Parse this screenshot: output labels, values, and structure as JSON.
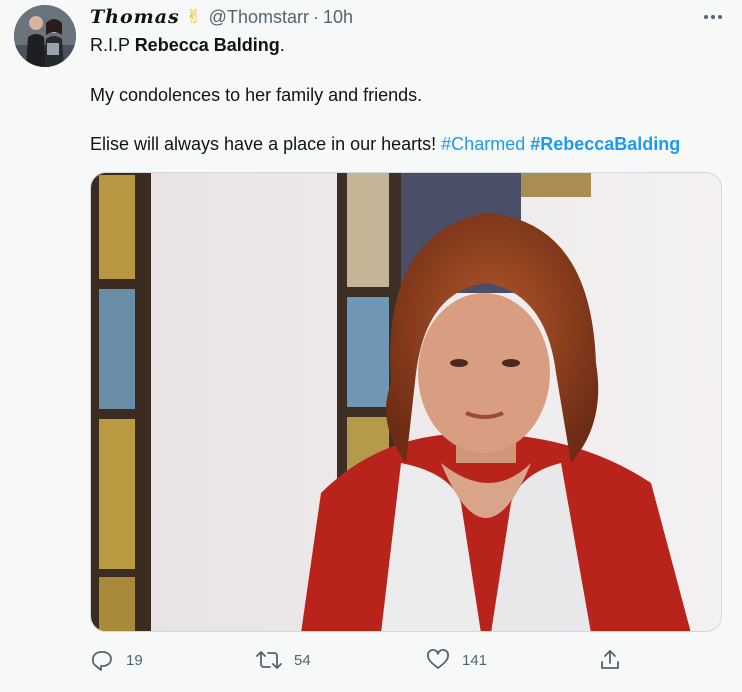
{
  "tweet": {
    "display_name": "Thomas",
    "emoji": "✌",
    "handle": "@Thomstarr",
    "separator": "·",
    "time": "10h",
    "line1": {
      "prefix": "R.I.P ",
      "bold": "Rebecca Balding",
      "suffix": "."
    },
    "line2": "My condolences to her family and friends.",
    "line3": {
      "text": "Elise will always have a place in our hearts! ",
      "hashtag1": "#Charmed",
      "hashtag2": "#RebeccaBalding"
    }
  },
  "actions": {
    "replies": "19",
    "retweets": "54",
    "likes": "141"
  },
  "colors": {
    "accent": "#1d9bf0",
    "muted": "#536471",
    "background": "#f7f9f9"
  },
  "icons": [
    "avatar-photo",
    "victory-hand-emoji",
    "more-icon",
    "reply-icon",
    "retweet-icon",
    "like-icon",
    "share-icon"
  ]
}
